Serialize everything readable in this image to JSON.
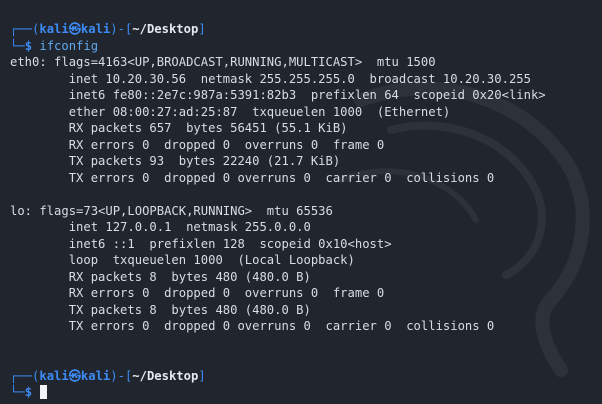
{
  "prompt": {
    "corner_top": "┌──(",
    "user": "kali",
    "at_symbol": "㉿",
    "host": "kali",
    "dir_open": ")-[",
    "cwd": "~/Desktop",
    "dir_close": "]",
    "corner_bottom": "└─",
    "dollar": "$"
  },
  "command": "ifconfig",
  "output": [
    "eth0: flags=4163<UP,BROADCAST,RUNNING,MULTICAST>  mtu 1500",
    "        inet 10.20.30.56  netmask 255.255.255.0  broadcast 10.20.30.255",
    "        inet6 fe80::2e7c:987a:5391:82b3  prefixlen 64  scopeid 0x20<link>",
    "        ether 08:00:27:ad:25:87  txqueuelen 1000  (Ethernet)",
    "        RX packets 657  bytes 56451 (55.1 KiB)",
    "        RX errors 0  dropped 0  overruns 0  frame 0",
    "        TX packets 93  bytes 22240 (21.7 KiB)",
    "        TX errors 0  dropped 0 overruns 0  carrier 0  collisions 0",
    "",
    "lo: flags=73<UP,LOOPBACK,RUNNING>  mtu 65536",
    "        inet 127.0.0.1  netmask 255.0.0.0",
    "        inet6 ::1  prefixlen 128  scopeid 0x10<host>",
    "        loop  txqueuelen 1000  (Local Loopback)",
    "        RX packets 8  bytes 480 (480.0 B)",
    "        RX errors 0  dropped 0  overruns 0  frame 0",
    "        TX packets 8  bytes 480 (480.0 B)",
    "        TX errors 0  dropped 0 overruns 0  carrier 0  collisions 0"
  ],
  "colors": {
    "background": "#21252d",
    "prompt_blue": "#3d8cf5",
    "text": "#d8dde3"
  },
  "icons": {
    "watermark": "kali-dragon-icon"
  }
}
